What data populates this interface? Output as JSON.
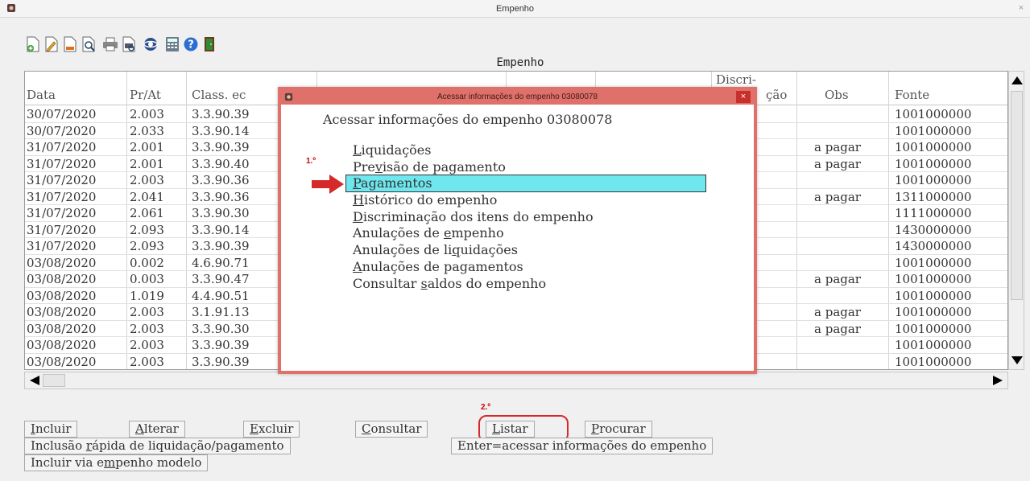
{
  "window": {
    "title": "Empenho",
    "close_glyph": "×"
  },
  "toolbar": {
    "icons": [
      "new-doc-icon",
      "edit-doc-icon",
      "blank-doc-icon",
      "preview-doc-icon",
      "print-icon",
      "print-preview-icon",
      "browser-icon",
      "calculator-icon",
      "help-icon",
      "exit-door-icon"
    ]
  },
  "grid": {
    "title": "Empenho",
    "columns": {
      "data": "Data",
      "prat": "Pr/At",
      "class": "Class. ec",
      "discri_top": "Discri-",
      "discri_bottom": "ção",
      "obs": "Obs",
      "fonte": "Fonte"
    },
    "rows": [
      {
        "data": "30/07/2020",
        "prat": "2.003",
        "class": "3.3.90.39",
        "obs": "",
        "fonte": "1001000000"
      },
      {
        "data": "30/07/2020",
        "prat": "2.033",
        "class": "3.3.90.14",
        "obs": "",
        "fonte": "1001000000"
      },
      {
        "data": "31/07/2020",
        "prat": "2.001",
        "class": "3.3.90.39",
        "obs": "a pagar",
        "fonte": "1001000000"
      },
      {
        "data": "31/07/2020",
        "prat": "2.001",
        "class": "3.3.90.40",
        "obs": "a pagar",
        "fonte": "1001000000"
      },
      {
        "data": "31/07/2020",
        "prat": "2.003",
        "class": "3.3.90.36",
        "obs": "",
        "fonte": "1001000000"
      },
      {
        "data": "31/07/2020",
        "prat": "2.041",
        "class": "3.3.90.36",
        "obs": "a pagar",
        "fonte": "1311000000"
      },
      {
        "data": "31/07/2020",
        "prat": "2.061",
        "class": "3.3.90.30",
        "obs": "",
        "fonte": "1111000000"
      },
      {
        "data": "31/07/2020",
        "prat": "2.093",
        "class": "3.3.90.14",
        "obs": "",
        "fonte": "1430000000"
      },
      {
        "data": "31/07/2020",
        "prat": "2.093",
        "class": "3.3.90.39",
        "obs": "",
        "fonte": "1430000000"
      },
      {
        "data": "03/08/2020",
        "prat": "0.002",
        "class": "4.6.90.71",
        "obs": "",
        "fonte": "1001000000"
      },
      {
        "data": "03/08/2020",
        "prat": "0.003",
        "class": "3.3.90.47",
        "obs": "a pagar",
        "fonte": "1001000000"
      },
      {
        "data": "03/08/2020",
        "prat": "1.019",
        "class": "4.4.90.51",
        "obs": "",
        "fonte": "1001000000"
      },
      {
        "data": "03/08/2020",
        "prat": "2.003",
        "class": "3.1.91.13",
        "obs": "a pagar",
        "fonte": "1001000000"
      },
      {
        "data": "03/08/2020",
        "prat": "2.003",
        "class": "3.3.90.30",
        "obs": "a pagar",
        "fonte": "1001000000"
      },
      {
        "data": "03/08/2020",
        "prat": "2.003",
        "class": "3.3.90.39",
        "obs": "",
        "fonte": "1001000000"
      },
      {
        "data": "03/08/2020",
        "prat": "2.003",
        "class": "3.3.90.39",
        "obs": "",
        "fonte": "1001000000"
      }
    ]
  },
  "dialog": {
    "title": "Acessar informações do empenho 03080078",
    "close_glyph": "×",
    "heading": "Acessar informações do empenho 03080078",
    "items": [
      {
        "pre": "",
        "u": "L",
        "post": "iquidações"
      },
      {
        "pre": "Pre",
        "u": "v",
        "post": "isão de pagamento"
      },
      {
        "pre": "",
        "u": "P",
        "post": "agamentos"
      },
      {
        "pre": "",
        "u": "H",
        "post": "istórico do empenho"
      },
      {
        "pre": "",
        "u": "D",
        "post": "iscriminação dos itens do empenho"
      },
      {
        "pre": "Anulações de ",
        "u": "e",
        "post": "mpenho"
      },
      {
        "pre": "Anulações de li",
        "u": "q",
        "post": "uidações"
      },
      {
        "pre": "",
        "u": "A",
        "post": "nulações de pagamentos"
      },
      {
        "pre": "Consultar ",
        "u": "s",
        "post": "aldos do empenho"
      }
    ],
    "selected_index": 2
  },
  "annotations": {
    "step1": "1.º",
    "step2": "2.º",
    "accent": "#d42a2a"
  },
  "buttons": {
    "incluir": {
      "pre": "",
      "u": "I",
      "post": "ncluir"
    },
    "alterar": {
      "pre": "",
      "u": "A",
      "post": "lterar"
    },
    "excluir": {
      "pre": "",
      "u": "E",
      "post": "xcluir"
    },
    "consultar": {
      "pre": "",
      "u": "C",
      "post": "onsultar"
    },
    "listar": {
      "pre": "",
      "u": "L",
      "post": "istar"
    },
    "procurar": {
      "pre": "",
      "u": "P",
      "post": "rocurar"
    },
    "inclusao_rapida": {
      "pre": "Inclusão ",
      "u": "r",
      "post": "ápida de liquidação/pagamento"
    },
    "enter_acessar": {
      "pre": "Enter=acessar informações do empenho",
      "u": "",
      "post": ""
    },
    "incluir_modelo": {
      "pre": "Incluir via e",
      "u": "m",
      "post": "penho modelo"
    }
  },
  "colors": {
    "selection": "#6fe7ef",
    "dialog_border": "#e0716a"
  }
}
